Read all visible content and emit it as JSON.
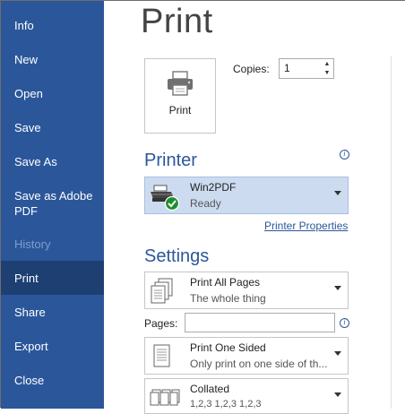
{
  "sidebar": {
    "items": [
      {
        "label": "Info",
        "state": "normal"
      },
      {
        "label": "New",
        "state": "normal"
      },
      {
        "label": "Open",
        "state": "normal"
      },
      {
        "label": "Save",
        "state": "normal"
      },
      {
        "label": "Save As",
        "state": "normal"
      },
      {
        "label_line1": "Save as Adobe",
        "label_line2": "PDF",
        "state": "normal"
      },
      {
        "label": "History",
        "state": "disabled"
      },
      {
        "label": "Print",
        "state": "active"
      },
      {
        "label": "Share",
        "state": "normal"
      },
      {
        "label": "Export",
        "state": "normal"
      },
      {
        "label": "Close",
        "state": "normal"
      }
    ]
  },
  "main": {
    "title": "Print",
    "print_button": {
      "label": "Print",
      "icon": "printer-icon"
    },
    "copies": {
      "label": "Copies:",
      "value": "1"
    },
    "printer_section": {
      "heading": "Printer",
      "info_icon": "i",
      "selected": {
        "name": "Win2PDF",
        "status": "Ready",
        "icon": "printer-ready-icon"
      },
      "properties_link": "Printer Properties"
    },
    "settings_section": {
      "heading": "Settings",
      "print_range": {
        "title": "Print All Pages",
        "subtitle": "The whole thing",
        "icon": "all-pages-icon"
      },
      "pages": {
        "label": "Pages:",
        "value": "",
        "info_icon": "i"
      },
      "sides": {
        "title": "Print One Sided",
        "subtitle": "Only print on one side of th...",
        "icon": "one-sided-icon"
      },
      "collation": {
        "title": "Collated",
        "subtitle": "1,2,3    1,2,3    1,2,3",
        "icon": "collated-icon"
      }
    }
  },
  "colors": {
    "sidebar_bg": "#2b579a",
    "sidebar_active": "#1d3f72",
    "accent": "#2b579a",
    "printer_selected_bg": "#cddbf0"
  }
}
